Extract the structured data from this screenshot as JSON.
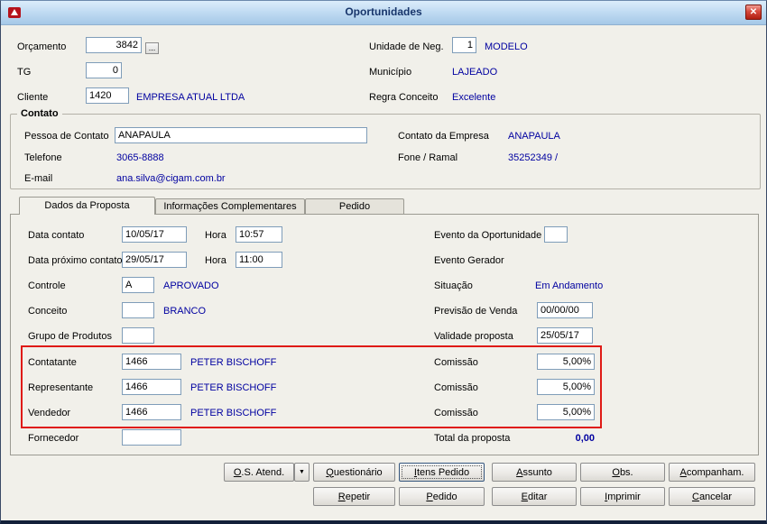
{
  "window": {
    "title": "Oportunidades"
  },
  "icons": {
    "close": "✕",
    "dropdown": "▼",
    "browse": "..."
  },
  "header": {
    "orcamento": {
      "label": "Orçamento",
      "value": "3842"
    },
    "tg": {
      "label": "TG",
      "value": "0"
    },
    "cliente": {
      "label": "Cliente",
      "value": "1420",
      "name": "EMPRESA ATUAL LTDA"
    },
    "unidade": {
      "label": "Unidade de Neg.",
      "value": "1",
      "name": "MODELO"
    },
    "municipio": {
      "label": "Município",
      "value": "LAJEADO"
    },
    "regra": {
      "label": "Regra Conceito",
      "value": "Excelente"
    }
  },
  "contato": {
    "title": "Contato",
    "pessoa": {
      "label": "Pessoa de Contato",
      "value": "ANAPAULA"
    },
    "contato_empresa": {
      "label": "Contato da Empresa",
      "value": "ANAPAULA"
    },
    "telefone": {
      "label": "Telefone",
      "value": "3065-8888"
    },
    "fone_ramal": {
      "label": "Fone / Ramal",
      "value": "35252349 /"
    },
    "email": {
      "label": "E-mail",
      "value": "ana.silva@cigam.com.br"
    }
  },
  "tabs": {
    "dados": "Dados da Proposta",
    "info": "Informações Complementares",
    "pedido": "Pedido"
  },
  "proposta": {
    "data_contato": {
      "label": "Data contato",
      "value": "10/05/17",
      "hora_label": "Hora",
      "hora": "10:57"
    },
    "data_proximo": {
      "label": "Data próximo contato",
      "value": "29/05/17",
      "hora_label": "Hora",
      "hora": "11:00"
    },
    "controle": {
      "label": "Controle",
      "value": "A",
      "desc": "APROVADO"
    },
    "conceito": {
      "label": "Conceito",
      "value": "",
      "desc": "BRANCO"
    },
    "grupo_produtos": {
      "label": "Grupo de Produtos",
      "value": ""
    },
    "contatante": {
      "label": "Contatante",
      "value": "1466",
      "name": "PETER BISCHOFF"
    },
    "representante": {
      "label": "Representante",
      "value": "1466",
      "name": "PETER BISCHOFF"
    },
    "vendedor": {
      "label": "Vendedor",
      "value": "1466",
      "name": "PETER BISCHOFF"
    },
    "fornecedor": {
      "label": "Fornecedor",
      "value": ""
    },
    "evento_oportunidade": {
      "label": "Evento da Oportunidade",
      "value": ""
    },
    "evento_gerador": {
      "label": "Evento Gerador"
    },
    "situacao": {
      "label": "Situação",
      "value": "Em Andamento"
    },
    "previsao_venda": {
      "label": "Previsão de Venda",
      "value": "00/00/00"
    },
    "validade_proposta": {
      "label": "Validade proposta",
      "value": "25/05/17"
    },
    "comissao1": {
      "label": "Comissão",
      "value": "5,00%"
    },
    "comissao2": {
      "label": "Comissão",
      "value": "5,00%"
    },
    "comissao3": {
      "label": "Comissão",
      "value": "5,00%"
    },
    "total": {
      "label": "Total da proposta",
      "value": "0,00"
    }
  },
  "buttons": {
    "os_atend": "O.S. Atend.",
    "questionario": "Questionário",
    "itens_pedido": "Itens Pedido",
    "assunto": "Assunto",
    "obs": "Obs.",
    "acompanham": "Acompanham.",
    "repetir": "Repetir",
    "pedido": "Pedido",
    "editar": "Editar",
    "imprimir": "Imprimir",
    "cancelar": "Cancelar"
  }
}
